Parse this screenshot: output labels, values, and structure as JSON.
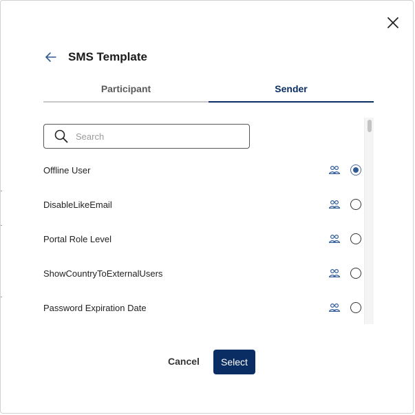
{
  "dialog": {
    "title": "SMS Template"
  },
  "icons": {
    "close": "close-icon",
    "back": "arrow-left-icon",
    "search": "search-icon",
    "group": "users-group-icon"
  },
  "tabs": [
    {
      "label": "Participant",
      "active": false
    },
    {
      "label": "Sender",
      "active": true
    }
  ],
  "search": {
    "placeholder": "Search",
    "value": ""
  },
  "items": [
    {
      "label": "Offline User",
      "selected": true
    },
    {
      "label": "DisableLikeEmail",
      "selected": false
    },
    {
      "label": "Portal Role Level",
      "selected": false
    },
    {
      "label": "ShowCountryToExternalUsers",
      "selected": false
    },
    {
      "label": "Password Expiration Date",
      "selected": false
    }
  ],
  "footer": {
    "cancel_label": "Cancel",
    "select_label": "Select"
  },
  "colors": {
    "primary": "#0a2e63",
    "radio_checked": "#2f5a93",
    "group_icon": "#2f5a93"
  }
}
